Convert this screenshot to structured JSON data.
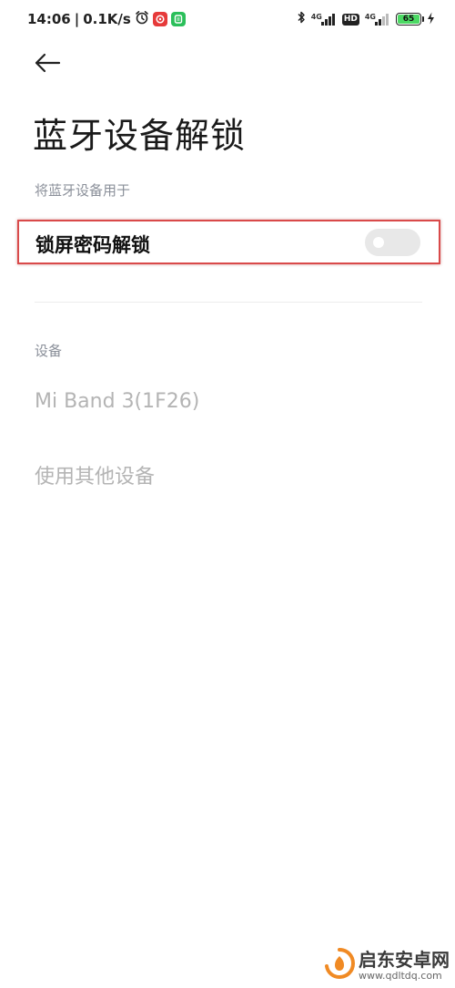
{
  "status_bar": {
    "time": "14:06",
    "separator": "|",
    "speed": "0.1K/s",
    "sim1_network": "4G",
    "sim2_network": "4G",
    "hd_label": "HD",
    "battery_level": "65",
    "battery_color": "#4cd964",
    "icons": [
      "alarm-icon",
      "netease-music-app-icon",
      "green-app-icon",
      "bluetooth-icon",
      "signal-icon",
      "hd-icon",
      "battery-icon",
      "charging-icon"
    ]
  },
  "header": {
    "back_icon": "back-arrow-icon",
    "title": "蓝牙设备解锁"
  },
  "use_section": {
    "label": "将蓝牙设备用于",
    "toggle_label": "锁屏密码解锁",
    "toggle_on": false,
    "highlight_color": "#d94a4a"
  },
  "devices_section": {
    "label": "设备",
    "items": [
      {
        "label": "Mi Band 3(1F26)"
      },
      {
        "label": "使用其他设备"
      }
    ]
  },
  "watermark": {
    "main": "启东安卓网",
    "url": "www.qdltdq.com"
  }
}
